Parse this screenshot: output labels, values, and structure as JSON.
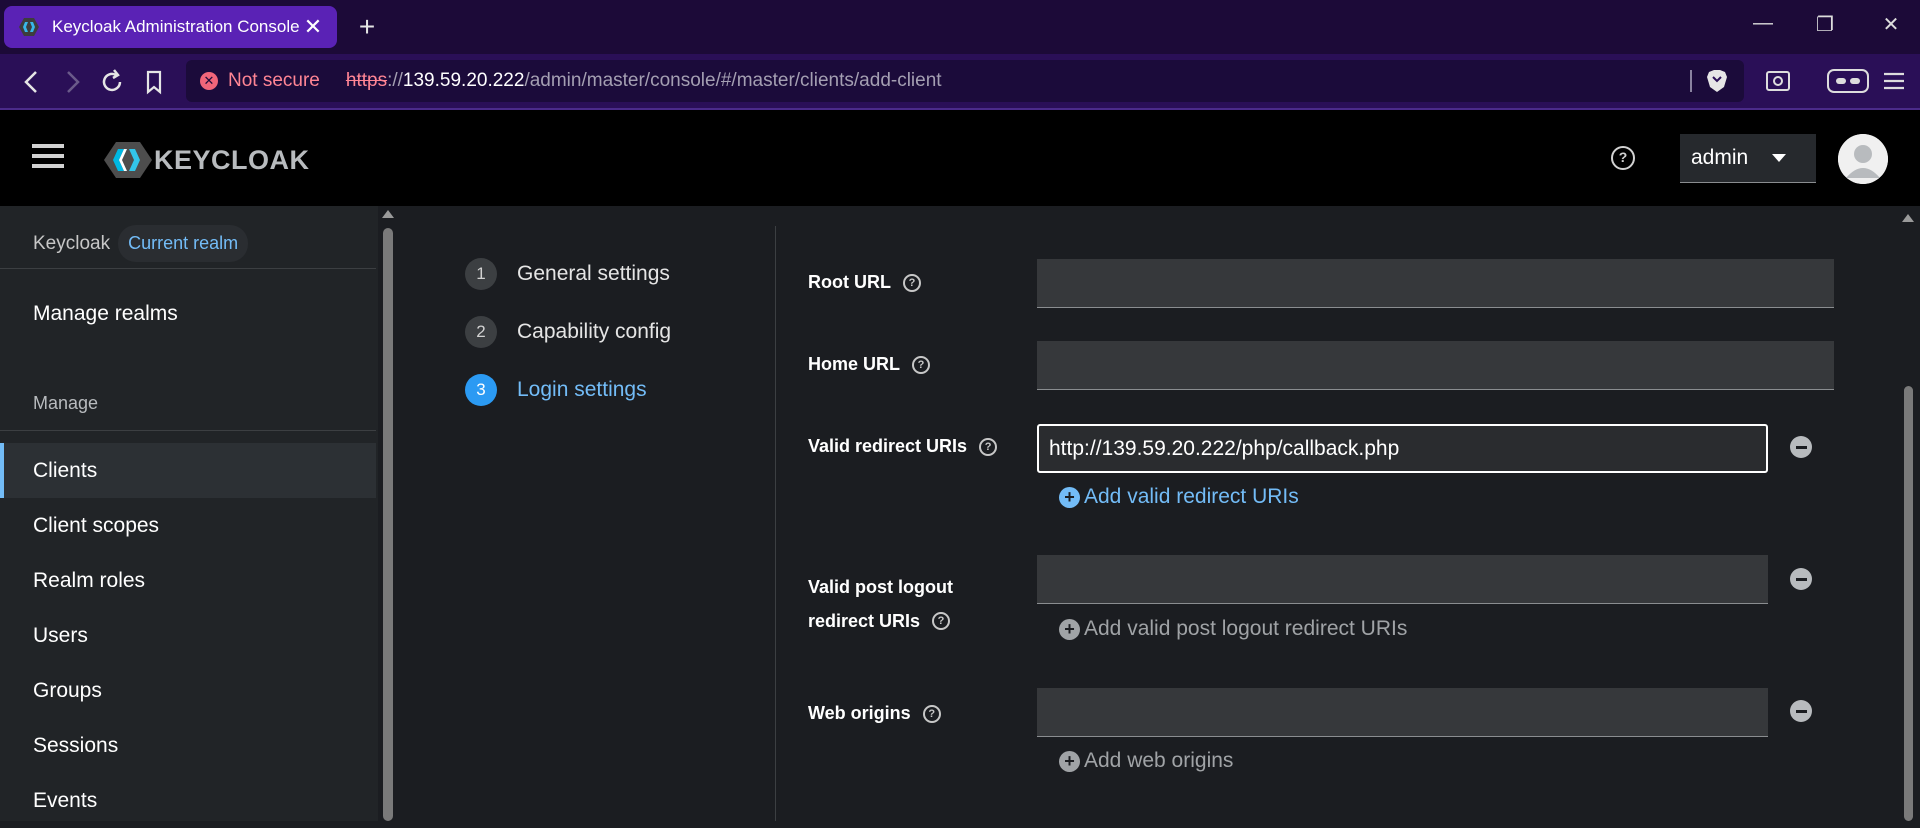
{
  "browser": {
    "tab_title": "Keycloak Administration Console",
    "security_label": "Not secure",
    "url_scheme": "https",
    "url_scheme_sep": "://",
    "url_host": "139.59.20.222",
    "url_path": "/admin/master/console/#/master/clients/add-client"
  },
  "header": {
    "logo_text": "KEYCLOAK",
    "user_name": "admin"
  },
  "sidebar": {
    "realm_prefix": "Keycloak",
    "realm_badge": "Current realm",
    "manage_realms": "Manage realms",
    "section_manage": "Manage",
    "items": [
      {
        "label": "Clients"
      },
      {
        "label": "Client scopes"
      },
      {
        "label": "Realm roles"
      },
      {
        "label": "Users"
      },
      {
        "label": "Groups"
      },
      {
        "label": "Sessions"
      },
      {
        "label": "Events"
      }
    ]
  },
  "wizard": {
    "steps": [
      {
        "num": "1",
        "label": "General settings"
      },
      {
        "num": "2",
        "label": "Capability config"
      },
      {
        "num": "3",
        "label": "Login settings"
      }
    ]
  },
  "form": {
    "root_url": {
      "label": "Root URL",
      "value": ""
    },
    "home_url": {
      "label": "Home URL",
      "value": ""
    },
    "redirect": {
      "label": "Valid redirect URIs",
      "value": "http://139.59.20.222/php/callback.php",
      "add": "Add valid redirect URIs"
    },
    "post_logout": {
      "label_line1": "Valid post logout",
      "label_line2": "redirect URIs",
      "value": "",
      "add": "Add valid post logout redirect URIs"
    },
    "web_origins": {
      "label": "Web origins",
      "value": "",
      "add": "Add web origins"
    }
  }
}
